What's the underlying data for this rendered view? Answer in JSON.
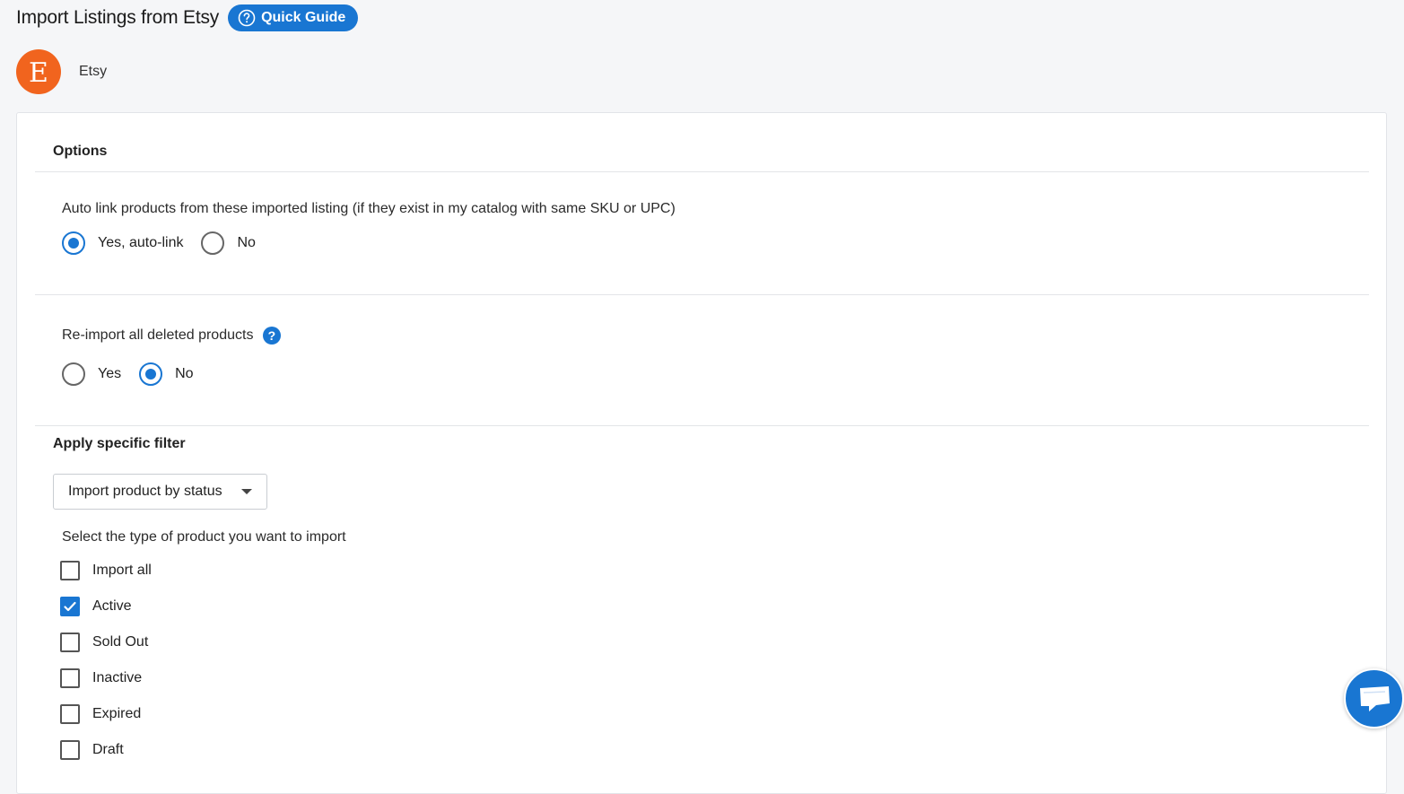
{
  "header": {
    "title": "Import Listings from Etsy",
    "guide_label": "Quick Guide"
  },
  "channel": {
    "logo_letter": "E",
    "name": "Etsy",
    "brand_color": "#f1641e"
  },
  "options": {
    "title": "Options",
    "auto_link": {
      "label": "Auto link products from these imported listing (if they exist in my catalog with same SKU or UPC)",
      "options": [
        "Yes, auto-link",
        "No"
      ],
      "selected": "Yes, auto-link"
    },
    "reimport": {
      "label": "Re-import all deleted products",
      "help_icon": "?",
      "options": [
        "Yes",
        "No"
      ],
      "selected": "No"
    }
  },
  "filter": {
    "title": "Apply specific filter",
    "select_value": "Import product by status",
    "type_label": "Select the type of product you want to import",
    "statuses": [
      {
        "label": "Import all",
        "checked": false
      },
      {
        "label": "Active",
        "checked": true
      },
      {
        "label": "Sold Out",
        "checked": false
      },
      {
        "label": "Inactive",
        "checked": false
      },
      {
        "label": "Expired",
        "checked": false
      },
      {
        "label": "Draft",
        "checked": false
      }
    ]
  },
  "colors": {
    "accent": "#1976d2"
  },
  "icons": {
    "guide": "question-circle-icon",
    "chat": "chat-bubble-icon"
  }
}
